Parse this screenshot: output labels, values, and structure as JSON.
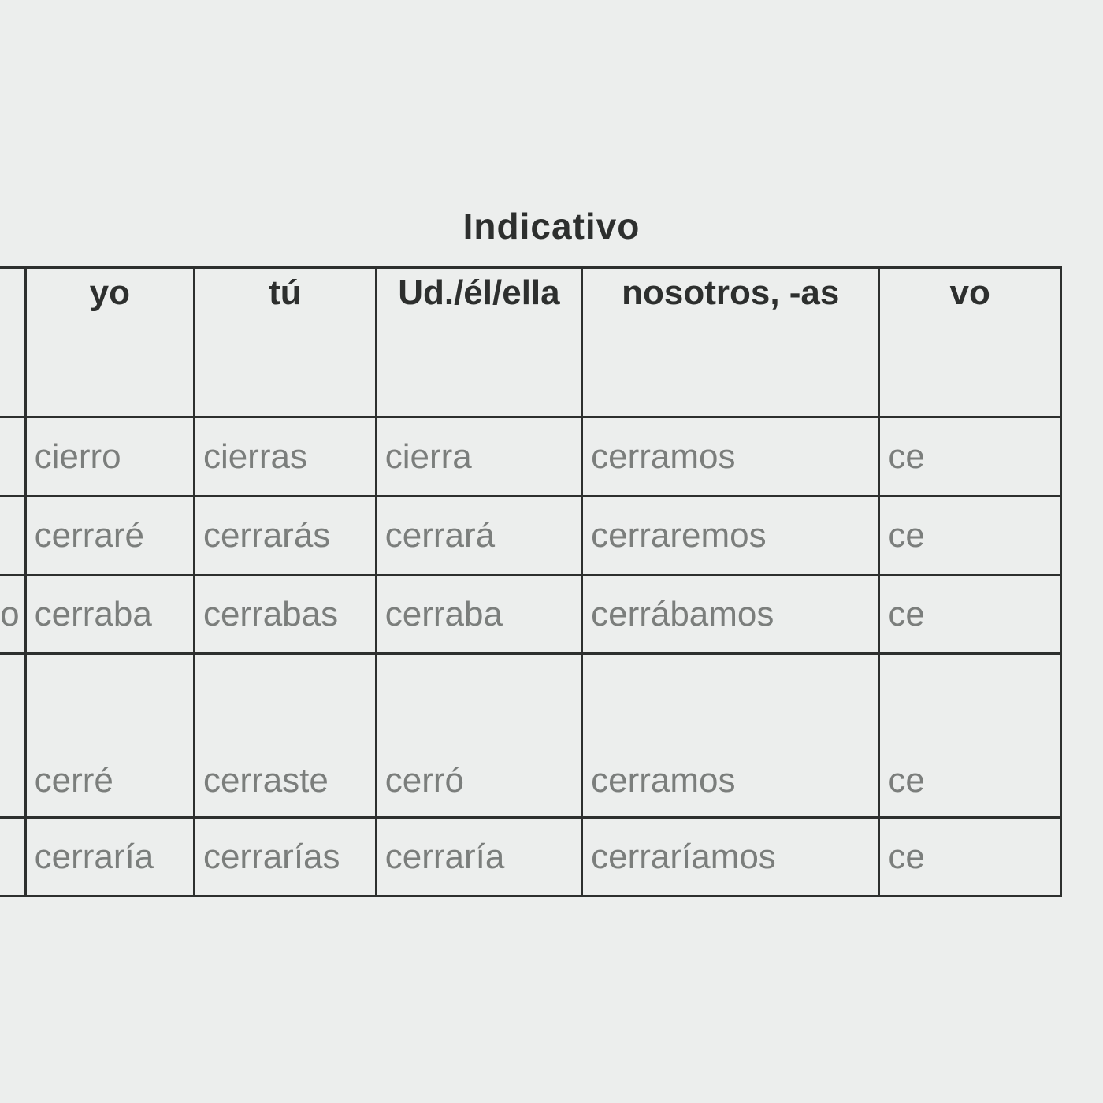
{
  "title": "Indicativo",
  "headers": {
    "row_label": "",
    "yo": "yo",
    "tu": "tú",
    "ud": "Ud./él/ella",
    "nos": "nosotros, -as",
    "vos": "vo"
  },
  "rows": [
    {
      "label": "",
      "yo": "cierro",
      "tu": "cierras",
      "ud": "cierra",
      "nos": "cerramos",
      "vos": "ce"
    },
    {
      "label": "",
      "yo": "cerraré",
      "tu": "cerrarás",
      "ud": "cerrará",
      "nos": "cerraremos",
      "vos": "ce"
    },
    {
      "label": "o",
      "yo": "cerraba",
      "tu": "cerrabas",
      "ud": "cerraba",
      "nos": "cerrábamos",
      "vos": "ce"
    },
    {
      "label": "",
      "yo": "cerré",
      "tu": "cerraste",
      "ud": "cerró",
      "nos": "cerramos",
      "vos": "ce"
    },
    {
      "label": "",
      "yo": "cerraría",
      "tu": "cerrarías",
      "ud": "cerraría",
      "nos": "cerraríamos",
      "vos": "ce"
    }
  ]
}
